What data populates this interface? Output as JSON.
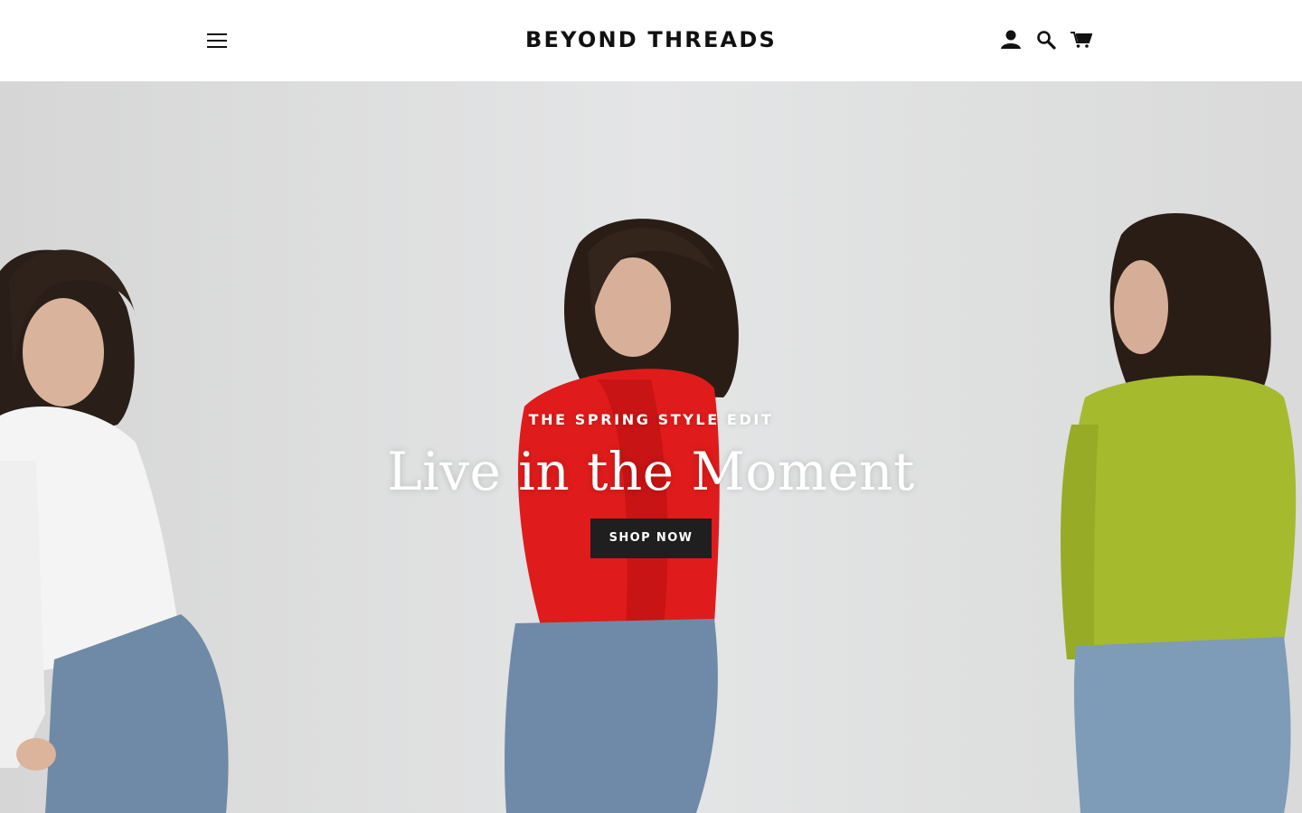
{
  "header": {
    "brand": "BEYOND THREADS",
    "icons": {
      "menu": "hamburger-menu-icon",
      "account": "user-account-icon",
      "search": "search-icon",
      "cart": "shopping-cart-icon"
    }
  },
  "hero": {
    "kicker": "THE SPRING STYLE EDIT",
    "title": "Live in the Moment",
    "cta_label": "SHOP NOW",
    "button_color": "#1f1f1f",
    "text_color": "#ffffff"
  }
}
